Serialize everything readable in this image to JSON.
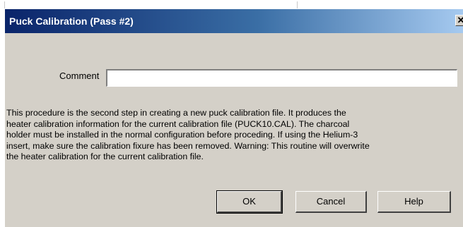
{
  "dialog": {
    "title": "Puck Calibration (Pass #2)",
    "close_glyph": "✕",
    "comment": {
      "label": "Comment",
      "value": "",
      "placeholder": ""
    },
    "description": "This procedure is the second step in creating a new puck calibration file.  It produces the\nheater calibration information for the current calibration file (PUCK10.CAL).  The charcoal\nholder must be installed in the normal configuration before proceding. If using the Helium-3\ninsert, make sure the calibration fixure has been removed.  Warning: This routine will overwrite\nthe heater calibration for the current calibration file.",
    "buttons": {
      "ok": "OK",
      "cancel": "Cancel",
      "help": "Help"
    }
  },
  "colors": {
    "title_bar_start": "#0a246a",
    "title_bar_end": "#a6caf0",
    "dialog_face": "#d4d0c8"
  }
}
